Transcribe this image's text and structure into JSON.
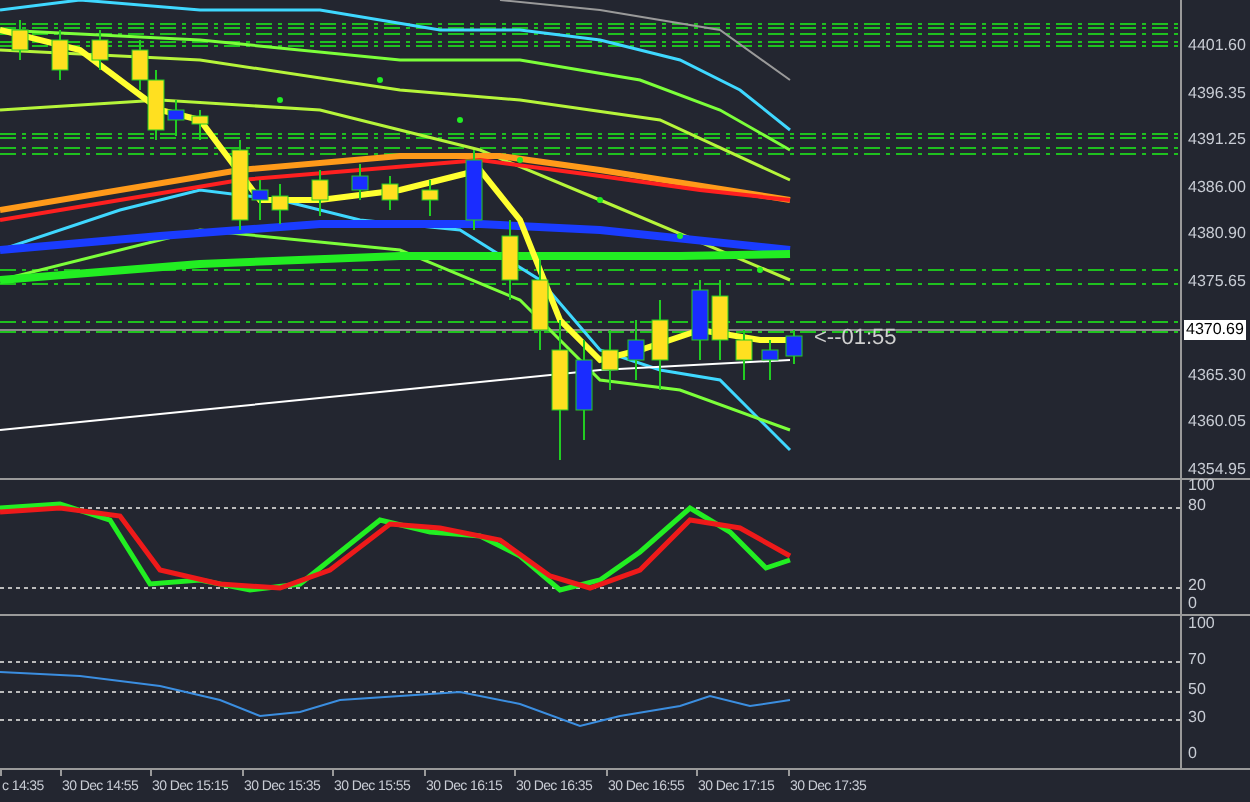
{
  "price_axis": {
    "labels": [
      "4401.60",
      "4396.35",
      "4391.25",
      "4386.00",
      "4380.90",
      "4375.65",
      "4365.30",
      "4360.05",
      "4354.95"
    ],
    "current_price": "4370.69"
  },
  "timer": "<--01:55",
  "stochastic": {
    "axis_labels": [
      "100",
      "80",
      "20",
      "0"
    ]
  },
  "rsi": {
    "axis_labels": [
      "100",
      "70",
      "50",
      "30",
      "0"
    ]
  },
  "time_axis": {
    "labels": [
      "c 14:35",
      "30 Dec 14:55",
      "30 Dec 15:15",
      "30 Dec 15:35",
      "30 Dec 15:55",
      "30 Dec 16:15",
      "30 Dec 16:35",
      "30 Dec 16:55",
      "30 Dec 17:15",
      "30 Dec 17:35"
    ]
  }
}
